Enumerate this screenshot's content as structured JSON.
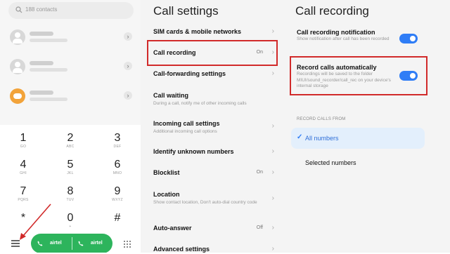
{
  "dialer": {
    "search_text": "188 contacts",
    "keys": [
      {
        "digit": "1",
        "letters": "GO"
      },
      {
        "digit": "2",
        "letters": "ABC"
      },
      {
        "digit": "3",
        "letters": "DEF"
      },
      {
        "digit": "4",
        "letters": "GHI"
      },
      {
        "digit": "5",
        "letters": "JKL"
      },
      {
        "digit": "6",
        "letters": "MNO"
      },
      {
        "digit": "7",
        "letters": "PQRS"
      },
      {
        "digit": "8",
        "letters": "TUV"
      },
      {
        "digit": "9",
        "letters": "WXYZ"
      },
      {
        "digit": "*",
        "letters": ""
      },
      {
        "digit": "0",
        "letters": "+"
      },
      {
        "digit": "#",
        "letters": ""
      }
    ],
    "sim1_label": "airtel",
    "sim2_label": "airtel",
    "icons": {
      "search": "search-icon",
      "menu": "menu-icon",
      "phone": "phone-icon",
      "dialpad": "dialpad-icon"
    },
    "call_color": "#2db45c"
  },
  "call_settings": {
    "title": "Call settings",
    "items": [
      {
        "label": "SIM cards & mobile networks",
        "sub": "",
        "value": ""
      },
      {
        "label": "Call recording",
        "sub": "",
        "value": "On"
      },
      {
        "label": "Call-forwarding settings",
        "sub": "",
        "value": ""
      },
      {
        "label": "Call waiting",
        "sub": "During a call, notify me of other incoming calls",
        "value": ""
      },
      {
        "label": "Incoming call settings",
        "sub": "Additional incoming call options",
        "value": ""
      },
      {
        "label": "Identify unknown numbers",
        "sub": "",
        "value": ""
      },
      {
        "label": "Blocklist",
        "sub": "",
        "value": "On"
      },
      {
        "label": "Location",
        "sub": "Show contact location, Don't auto-dial country code",
        "value": ""
      },
      {
        "label": "Auto-answer",
        "sub": "",
        "value": "Off"
      },
      {
        "label": "Advanced settings",
        "sub": "",
        "value": ""
      }
    ]
  },
  "call_recording": {
    "title": "Call recording",
    "notification": {
      "label": "Call recording notification",
      "sub": "Show notification after call has been recorded",
      "enabled": true
    },
    "auto": {
      "label": "Record calls automatically",
      "sub": "Recordings will be saved to the folder MIUI/sound_recorder/call_rec on your device's internal storage",
      "enabled": true
    },
    "section_label": "RECORD CALLS FROM",
    "options": [
      {
        "label": "All numbers",
        "selected": true
      },
      {
        "label": "Selected numbers",
        "selected": false
      }
    ],
    "accent": "#2f7df6",
    "highlight": "#d12a2a"
  }
}
